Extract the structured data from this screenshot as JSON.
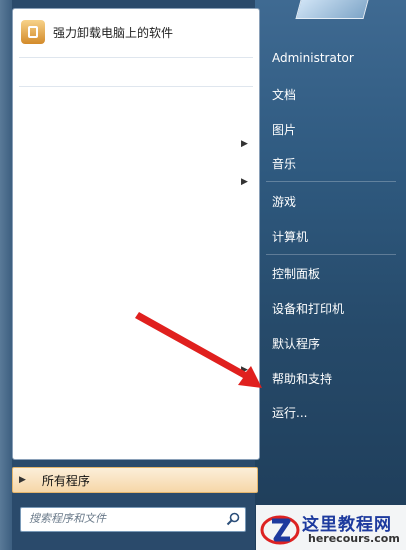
{
  "start_menu": {
    "pinned_program": {
      "label": "强力卸载电脑上的软件",
      "icon": "uninstaller-icon"
    },
    "all_programs": "所有程序",
    "search": {
      "placeholder": "搜索程序和文件",
      "icon": "search-icon"
    }
  },
  "right_panel": {
    "items": [
      "Administrator",
      "文档",
      "图片",
      "音乐",
      "游戏",
      "计算机",
      "控制面板",
      "设备和打印机",
      "默认程序",
      "帮助和支持",
      "运行..."
    ]
  },
  "annotation": {
    "color": "#e0201e"
  },
  "watermark": {
    "title": "这里教程网",
    "url": "herecours.com"
  }
}
